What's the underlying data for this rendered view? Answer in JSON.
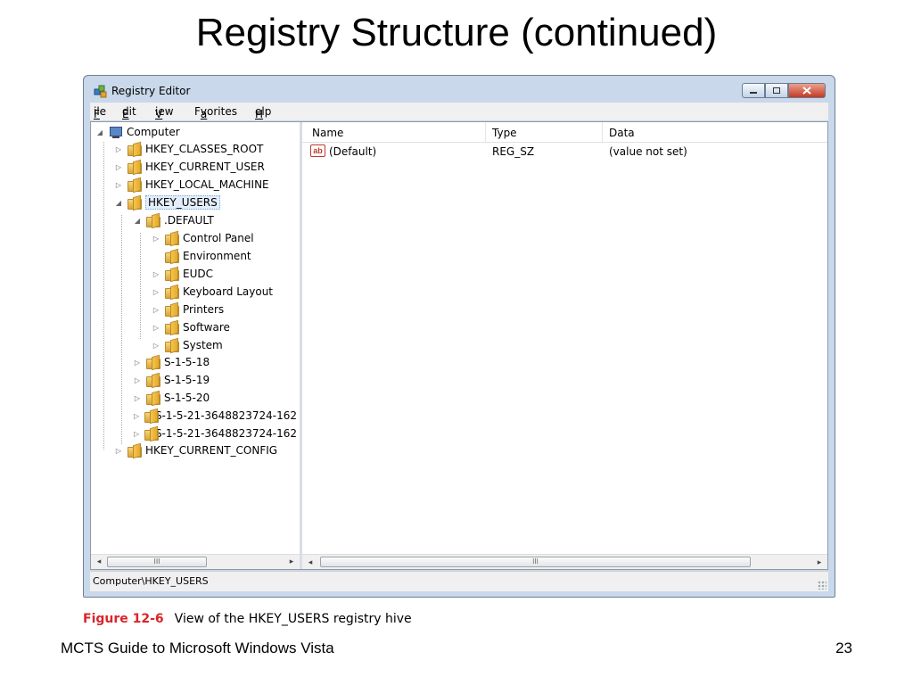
{
  "slide": {
    "title": "Registry Structure (continued)",
    "figure_label": "Figure 12-6",
    "figure_caption": "View of the HKEY_USERS registry hive",
    "footer_left": "MCTS Guide to Microsoft Windows Vista",
    "page_number": "23"
  },
  "window": {
    "title": "Registry Editor",
    "caption_buttons": [
      "minimize",
      "maximize",
      "close"
    ],
    "menu": [
      {
        "label": "File",
        "accel": "F"
      },
      {
        "label": "Edit",
        "accel": "E"
      },
      {
        "label": "View",
        "accel": "V"
      },
      {
        "label": "Favorites",
        "accel": "a"
      },
      {
        "label": "Help",
        "accel": "H"
      }
    ]
  },
  "tree": {
    "root": "Computer",
    "items": [
      {
        "label": "HKEY_CLASSES_ROOT",
        "expander": "▷"
      },
      {
        "label": "HKEY_CURRENT_USER",
        "expander": "▷"
      },
      {
        "label": "HKEY_LOCAL_MACHINE",
        "expander": "▷"
      },
      {
        "label": "HKEY_USERS",
        "expander": "◢",
        "selected": true
      },
      {
        "label": ".DEFAULT",
        "expander": "◢"
      },
      {
        "label": "Control Panel",
        "expander": "▷"
      },
      {
        "label": "Environment",
        "expander": ""
      },
      {
        "label": "EUDC",
        "expander": "▷"
      },
      {
        "label": "Keyboard Layout",
        "expander": "▷"
      },
      {
        "label": "Printers",
        "expander": "▷"
      },
      {
        "label": "Software",
        "expander": "▷"
      },
      {
        "label": "System",
        "expander": "▷"
      },
      {
        "label": "S-1-5-18",
        "expander": "▷"
      },
      {
        "label": "S-1-5-19",
        "expander": "▷"
      },
      {
        "label": "S-1-5-20",
        "expander": "▷"
      },
      {
        "label": "S-1-5-21-3648823724-162",
        "expander": "▷"
      },
      {
        "label": "S-1-5-21-3648823724-162",
        "expander": "▷"
      },
      {
        "label": "HKEY_CURRENT_CONFIG",
        "expander": "▷"
      }
    ]
  },
  "list": {
    "columns": [
      "Name",
      "Type",
      "Data"
    ],
    "rows": [
      {
        "icon": "ab",
        "name": "(Default)",
        "type": "REG_SZ",
        "data": "(value not set)"
      }
    ]
  },
  "scrollbar": {
    "thumb_grip": "III",
    "left_arrow": "◂",
    "right_arrow": "▸"
  },
  "status": {
    "path": "Computer\\HKEY_USERS"
  }
}
